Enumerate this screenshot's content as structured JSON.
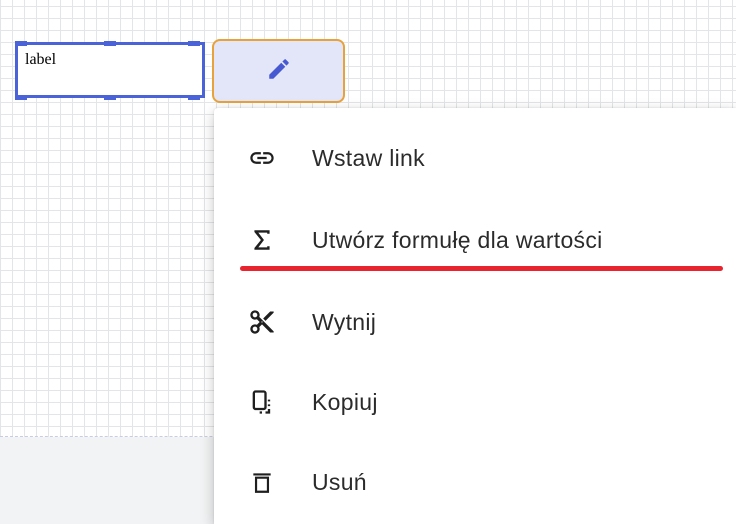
{
  "canvas": {
    "label_text": "label"
  },
  "toolbar": {
    "edit_icon": "pencil-icon"
  },
  "menu": {
    "items": [
      {
        "label": "Wstaw link",
        "icon": "link-icon"
      },
      {
        "label": "Utwórz formułę dla wartości",
        "icon": "sigma-icon"
      },
      {
        "label": "Wytnij",
        "icon": "scissors-icon"
      },
      {
        "label": "Kopiuj",
        "icon": "copy-icon"
      },
      {
        "label": "Usuń",
        "icon": "trash-icon"
      }
    ]
  },
  "colors": {
    "selection": "#4a63d8",
    "accent_border": "#e8a23b",
    "highlight_underline": "#e8242f"
  }
}
